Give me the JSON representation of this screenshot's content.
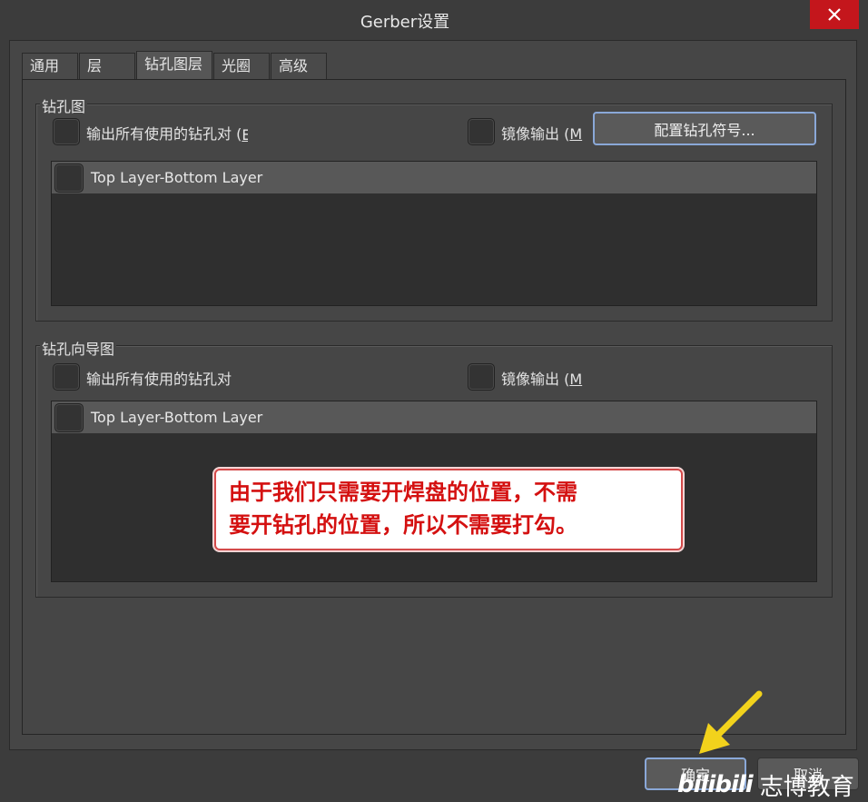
{
  "window": {
    "title": "Gerber设置"
  },
  "tabs": [
    {
      "label": "通用"
    },
    {
      "label": "层"
    },
    {
      "label": "钻孔图层"
    },
    {
      "label": "光圈"
    },
    {
      "label": "高级"
    }
  ],
  "drill_drawing": {
    "group_label": "钻孔图",
    "output_all_label": "输出所有使用的钻孔对 (",
    "output_all_underline": "E",
    "mirror_label": "镜像输出 (",
    "mirror_underline": "M",
    "config_button": "配置钻孔符号...",
    "layer_pairs": [
      "Top Layer-Bottom Layer"
    ]
  },
  "drill_guide": {
    "group_label": "钻孔向导图",
    "output_all_label": "输出所有使用的钻孔对",
    "mirror_label": "镜像输出 (",
    "mirror_underline": "M",
    "layer_pairs": [
      "Top Layer-Bottom Layer"
    ]
  },
  "annotation": {
    "line1": "由于我们只需要开焊盘的位置，不需",
    "line2": "要开钻孔的位置，所以不需要打勾。"
  },
  "footer": {
    "ok_button": "确定",
    "cancel_button": "取消"
  },
  "watermark": {
    "logo": "bilibili",
    "brand": "志博教育"
  },
  "colors": {
    "close_button": "#c4161c",
    "annotation_text": "#d41010",
    "arrow": "#f2d21c"
  }
}
